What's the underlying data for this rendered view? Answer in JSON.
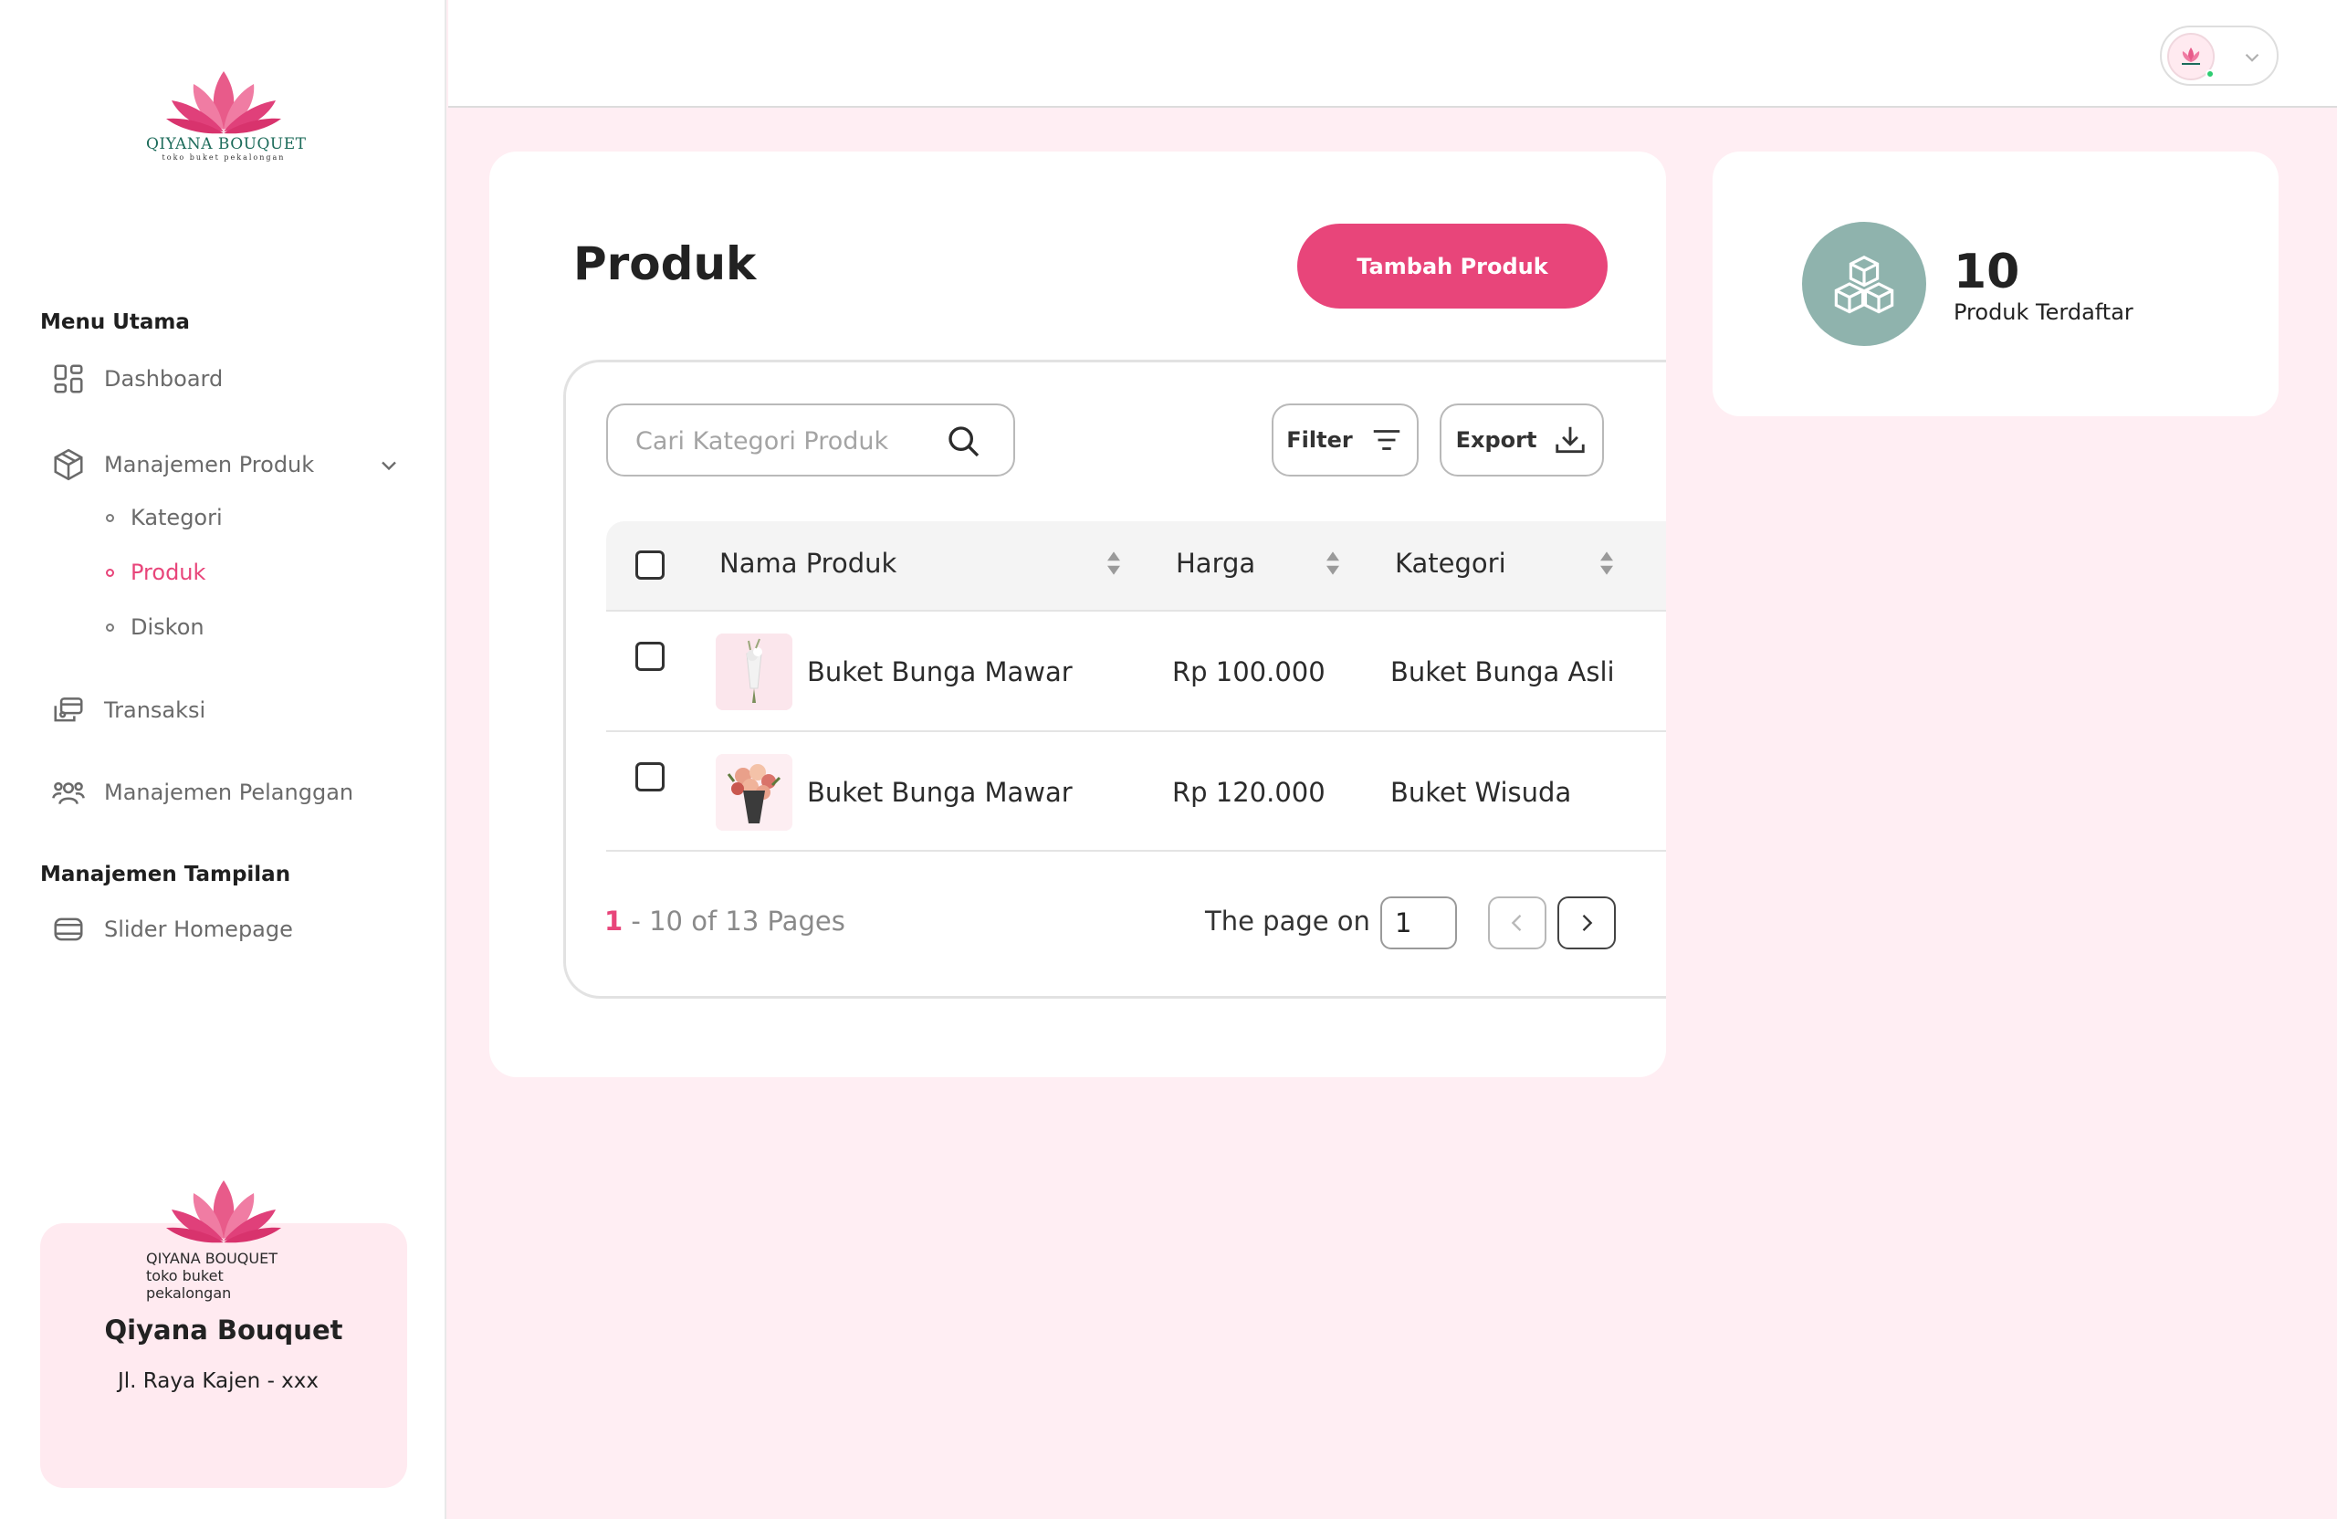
{
  "brand": {
    "name": "QIYANA BOUQUET",
    "tagline": "toko buket pekalongan"
  },
  "sidebar": {
    "section_main": "Menu Utama",
    "dashboard": "Dashboard",
    "product_mgmt": "Manajemen Produk",
    "sub_items": [
      "Kategori",
      "Produk",
      "Diskon"
    ],
    "active_sub": "Produk",
    "transactions": "Transaksi",
    "customers": "Manajemen Pelanggan",
    "section_display": "Manajemen Tampilan",
    "slider": "Slider Homepage"
  },
  "store": {
    "name": "Qiyana Bouquet",
    "address": "Jl. Raya Kajen - xxx"
  },
  "main": {
    "title": "Produk",
    "add_button": "Tambah Produk",
    "search_placeholder": "Cari Kategori Produk",
    "filter_label": "Filter",
    "export_label": "Export",
    "columns": [
      "Nama Produk",
      "Harga",
      "Kategori"
    ],
    "rows": [
      {
        "name": "Buket Bunga Mawar",
        "price": "Rp 100.000",
        "category": "Buket Bunga Asli"
      },
      {
        "name": "Buket Bunga Mawar",
        "price": "Rp 120.000",
        "category": "Buket Wisuda"
      }
    ],
    "pagination": {
      "current": "1",
      "range_text": " - 10 of 13 Pages",
      "page_on_label": "The page on",
      "page_value": "1"
    }
  },
  "stats": {
    "count": "10",
    "label": "Produk Terdaftar"
  },
  "colors": {
    "accent": "#e8457a",
    "background": "#ffeef3",
    "stat_icon_bg": "#8fb3ad"
  }
}
